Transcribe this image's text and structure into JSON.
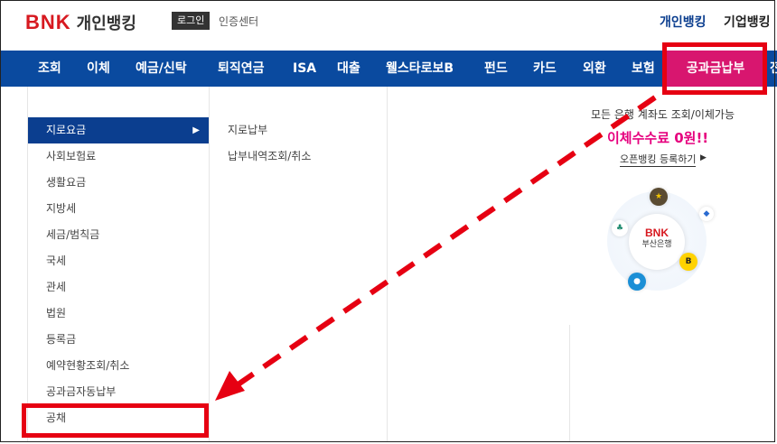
{
  "header": {
    "logo_brand": "BNK",
    "logo_name": "개인뱅킹",
    "login_label": "로그인",
    "cert_label": "인증센터",
    "tab_personal": "개인뱅킹",
    "tab_corporate": "기업뱅킹"
  },
  "nav": {
    "items": [
      "조회",
      "이체",
      "예금/신탁",
      "퇴직연금",
      "ISA",
      "대출",
      "웰스타로보B",
      "펀드",
      "카드",
      "외환",
      "보험",
      "공과금납부",
      "전"
    ],
    "active": "공과금납부"
  },
  "sidebar": {
    "items": [
      "지로요금",
      "사회보험료",
      "생활요금",
      "지방세",
      "세금/범칙금",
      "국세",
      "관세",
      "법원",
      "등록금",
      "예약현황조회/취소",
      "공과금자동납부",
      "공채"
    ],
    "active": "지로요금"
  },
  "submenu": {
    "items": [
      "지로납부",
      "납부내역조회/취소"
    ]
  },
  "promo": {
    "line1": "모든 은행 계좌도 조회/이체가능",
    "line2": "이체수수료 0원!!",
    "link": "오픈뱅킹 등록하기",
    "center_brand": "BNK",
    "center_name": "부산은행",
    "bank_b": "B"
  },
  "colors": {
    "nav_bg": "#0a4a9f",
    "nav_active": "#d8166f",
    "sidebar_active": "#0b3e8f",
    "highlight": "#e60012",
    "promo_pink": "#e6007e"
  }
}
